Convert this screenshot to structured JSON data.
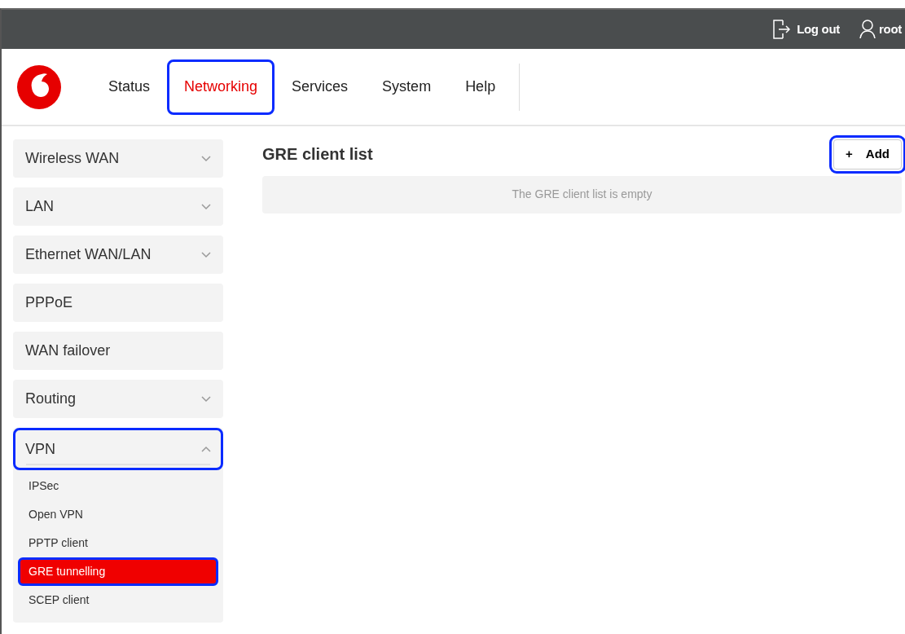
{
  "topbar": {
    "logout": "Log out",
    "user": "root"
  },
  "nav": {
    "tabs": [
      {
        "label": "Status",
        "selected": false,
        "highlighted": false
      },
      {
        "label": "Networking",
        "selected": true,
        "highlighted": true
      },
      {
        "label": "Services",
        "selected": false,
        "highlighted": false
      },
      {
        "label": "System",
        "selected": false,
        "highlighted": false
      },
      {
        "label": "Help",
        "selected": false,
        "highlighted": false
      }
    ]
  },
  "sidebar": {
    "items": [
      {
        "label": "Wireless WAN",
        "kind": "group",
        "expanded": false,
        "highlighted": false
      },
      {
        "label": "LAN",
        "kind": "group",
        "expanded": false,
        "highlighted": false
      },
      {
        "label": "Ethernet WAN/LAN",
        "kind": "group",
        "expanded": false,
        "highlighted": false
      },
      {
        "label": "PPPoE",
        "kind": "link",
        "highlighted": false
      },
      {
        "label": "WAN failover",
        "kind": "link",
        "highlighted": false
      },
      {
        "label": "Routing",
        "kind": "group",
        "expanded": false,
        "highlighted": false
      },
      {
        "label": "VPN",
        "kind": "group",
        "expanded": true,
        "highlighted": true,
        "children": [
          {
            "label": "IPSec",
            "selected": false,
            "highlighted": false
          },
          {
            "label": "Open VPN",
            "selected": false,
            "highlighted": false
          },
          {
            "label": "PPTP client",
            "selected": false,
            "highlighted": false
          },
          {
            "label": "GRE tunnelling",
            "selected": true,
            "highlighted": true
          },
          {
            "label": "SCEP client",
            "selected": false,
            "highlighted": false
          }
        ]
      }
    ]
  },
  "content": {
    "title": "GRE client list",
    "add_button": {
      "icon": "+",
      "label": "Add",
      "highlighted": true
    },
    "empty_message": "The GRE client list is empty"
  }
}
